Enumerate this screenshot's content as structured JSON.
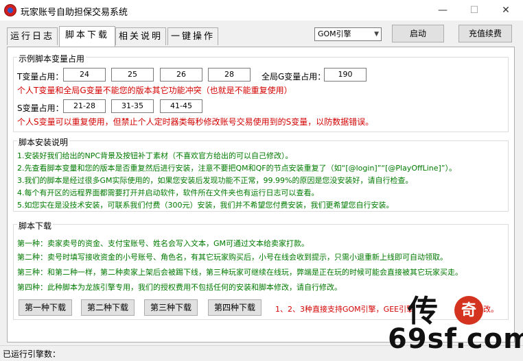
{
  "window": {
    "title": "玩家账号自助担保交易系统",
    "minimize": "—",
    "maximize": "☐",
    "close": "✕"
  },
  "tabs": [
    {
      "label": "运行日志"
    },
    {
      "label": "脚本下载"
    },
    {
      "label": "相关说明"
    },
    {
      "label": "一键操作"
    }
  ],
  "toolbar": {
    "engine_select": "GOM引擎",
    "start_button": "启动",
    "recharge_button": "充值续费"
  },
  "vars": {
    "title": "示例脚本变量占用",
    "t_label": "T变量占用：",
    "t_values": [
      "24",
      "25",
      "26",
      "28"
    ],
    "g_label": "全局G变量占用：",
    "g_value": "190",
    "note1": "个人T变量和全局G变量不能您的版本其它功能冲突（也就是不能重复使用）",
    "s_label": "S变量占用：",
    "s_values": [
      "21-28",
      "31-35",
      "41-45"
    ],
    "note2": "个人S变量可以重复使用，但禁止个人定时器类每秒修改账号交易使用到的S变量，以防数据错误。"
  },
  "install": {
    "title": "脚本安装说明",
    "lines": [
      "1.安装好我们给出的NPC背景及按钮补丁素材（不喜欢官方给出的可以自己修改）。",
      "2.先查看脚本变量和您的版本是否重复然后进行安装，注意不要把QM和QF的节点安装重复了（如“[@login]”“[@PlayOffLine]”）。",
      "3.我们的脚本是经过很多GM实际使用的，如果您安装后发现功能不正常，99.99%的原因是您没安装好，请自行检查。",
      "4.每个有开区的远程界面都需要打开并启动软件，软件所在文件夹也有运行日志可以查看。",
      "5.如您实在是没技术安装，可联系我们付费（300元）安装，我们并不希望您付费安装，我们更希望您自行安装。"
    ]
  },
  "download": {
    "title": "脚本下载",
    "lines": [
      "第一种：卖家卖号的资金、支付宝账号、姓名会写入文本，GM可通过文本给卖家打款。",
      "第二种：卖号时填写接收资金的小号账号、角色名，有其它玩家购买后，小号在线会收到提示，只需小退重新上线即可自动领取。",
      "第三种：和第二种一样，第二种卖家上架后会被踢下线，第三种玩家可继续在线玩，弊端是正在玩的时候可能会直接被其它玩家买走。",
      "第四种：此种脚本为龙族引擎专用，我们的授权费用不包括任何的安装和脚本修改，请自行修改。"
    ],
    "buttons": [
      "第一种下载",
      "第二种下载",
      "第三种下载",
      "第四种下载"
    ],
    "note_a": "1、2、3种直接支持GOM引擎，GEE引擎",
    "note_b": "改。"
  },
  "status": {
    "text": "已运行引擎数："
  },
  "watermark": {
    "char": "传",
    "circle": "奇",
    "url": "69sf.com"
  }
}
